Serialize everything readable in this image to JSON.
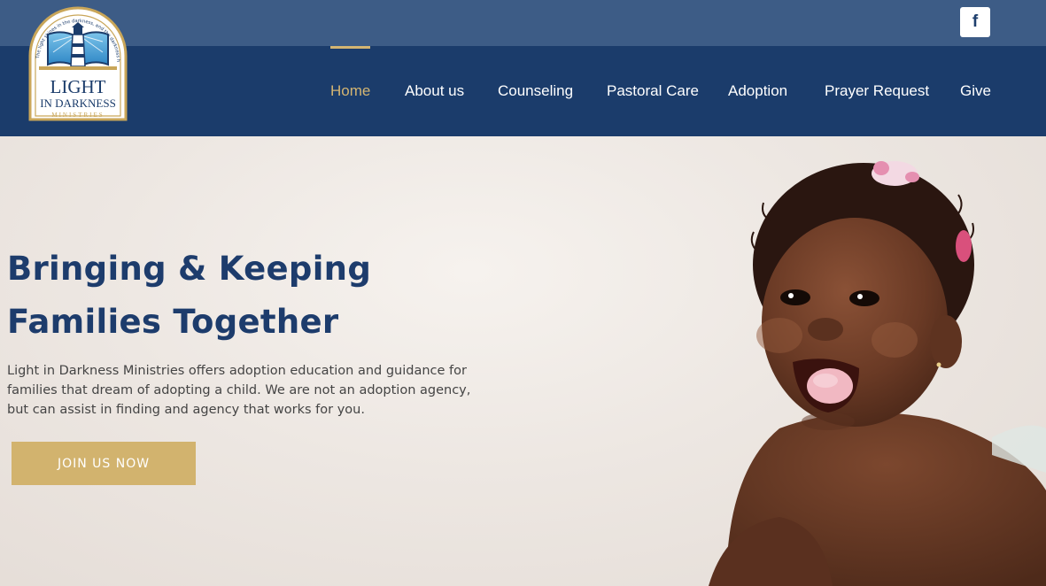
{
  "social": {
    "facebook_icon": "facebook-icon",
    "facebook_glyph": "f"
  },
  "logo": {
    "line1": "LIGHT",
    "line2": "IN DARKNESS",
    "line3": "MINISTRIES",
    "arc_text": "The light shines in the darkness, and the darkness has not overcome it. John 1:5",
    "colors": {
      "navy": "#1b3c6b",
      "gold": "#c9a659",
      "sky": "#4fa8d8"
    }
  },
  "nav": {
    "items": [
      {
        "label": "Home",
        "active": true
      },
      {
        "label": "About us"
      },
      {
        "label": "Counseling"
      },
      {
        "label": "Pastoral Care"
      },
      {
        "label": "Adoption"
      },
      {
        "label": "Prayer Request"
      },
      {
        "label": "Give"
      }
    ]
  },
  "hero": {
    "headline_line1": "Bringing & Keeping",
    "headline_line2": "Families Together",
    "description": "Light in Darkness Ministries offers adoption education and guidance for families that dream of adopting a child. We are not an adoption agency, but can assist in finding and agency that works for you.",
    "cta_label": "JOIN US NOW",
    "image": "smiling-baby-photo"
  },
  "colors": {
    "topbar": "#3d5c86",
    "navbar": "#1b3c6b",
    "accent_gold": "#d2b36e",
    "heading_navy": "#1d3c6c"
  }
}
